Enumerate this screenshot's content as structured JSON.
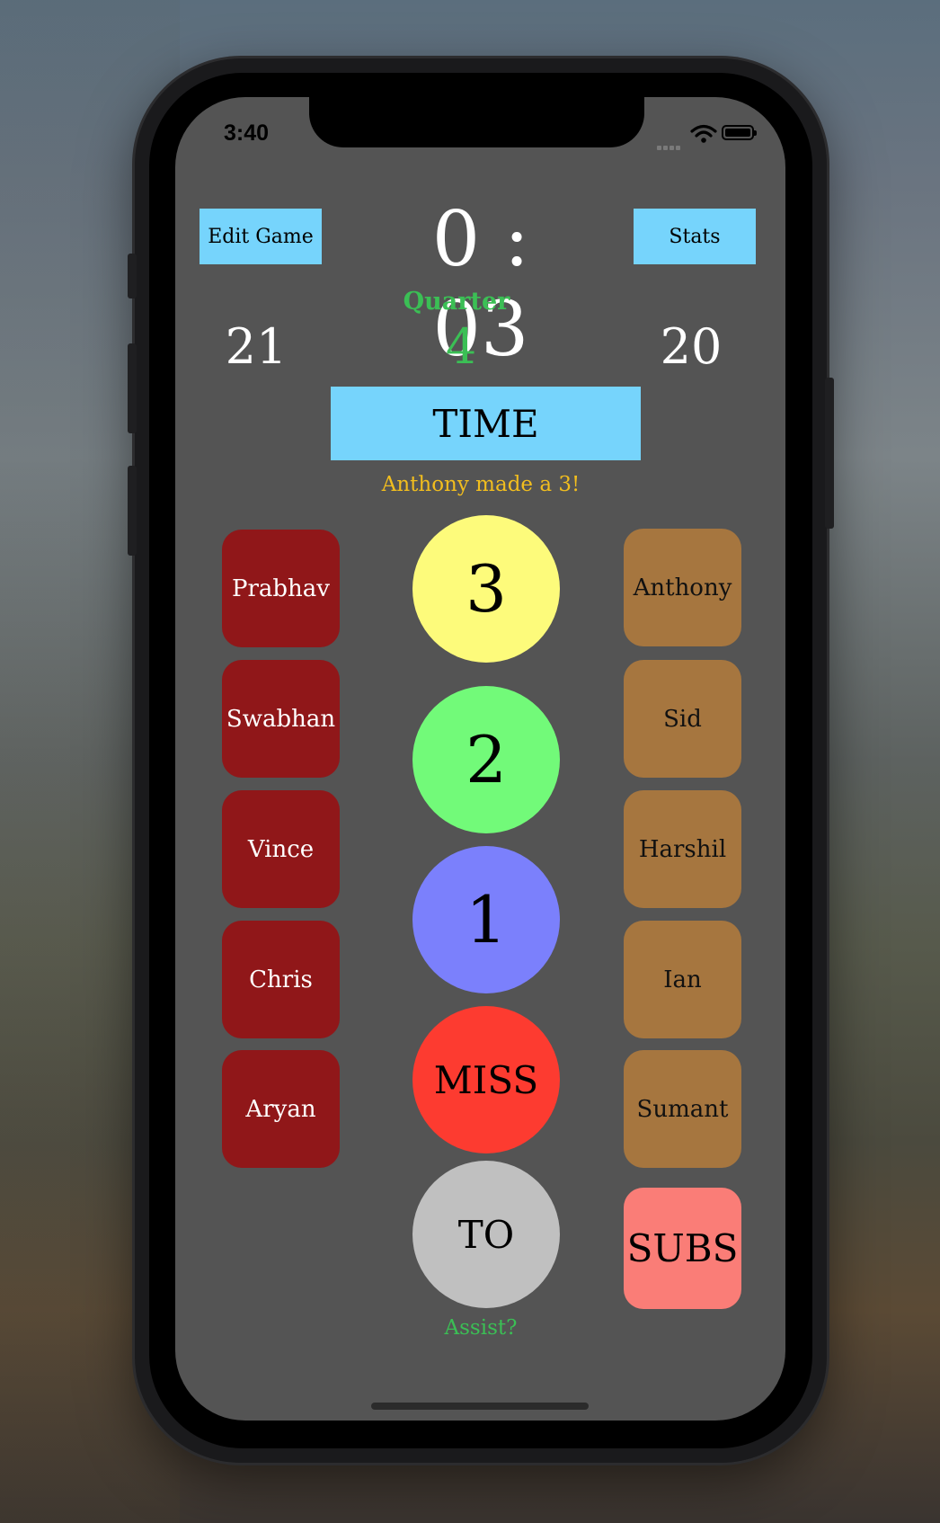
{
  "status_bar": {
    "time": "3:40"
  },
  "header": {
    "edit_game_label": "Edit Game",
    "clock": "0 : 03",
    "stats_label": "Stats"
  },
  "quarter": {
    "label": "Quarter",
    "value": "4"
  },
  "scores": {
    "left": "21",
    "right": "20"
  },
  "time_button_label": "TIME",
  "play_message": "Anthony made a 3!",
  "left_team": [
    "Prabhav",
    "Swabhan",
    "Vince",
    "Chris",
    "Aryan"
  ],
  "right_team": [
    "Anthony",
    "Sid",
    "Harshil",
    "Ian",
    "Sumant"
  ],
  "actions": {
    "three": "3",
    "two": "2",
    "one": "1",
    "miss": "MISS",
    "timeout": "TO"
  },
  "subs_label": "SUBS",
  "assist_label": "Assist?",
  "colors": {
    "accent_blue": "#76d4fc",
    "left_team": "#901719",
    "right_team": "#a6763f",
    "three": "#fdfb7b",
    "two": "#72fa79",
    "one": "#7b80fc",
    "miss": "#fd3b30",
    "timeout": "#c0c0c0",
    "subs": "#fa7d77",
    "green_text": "#3bbf55",
    "message_text": "#f2be1e"
  }
}
